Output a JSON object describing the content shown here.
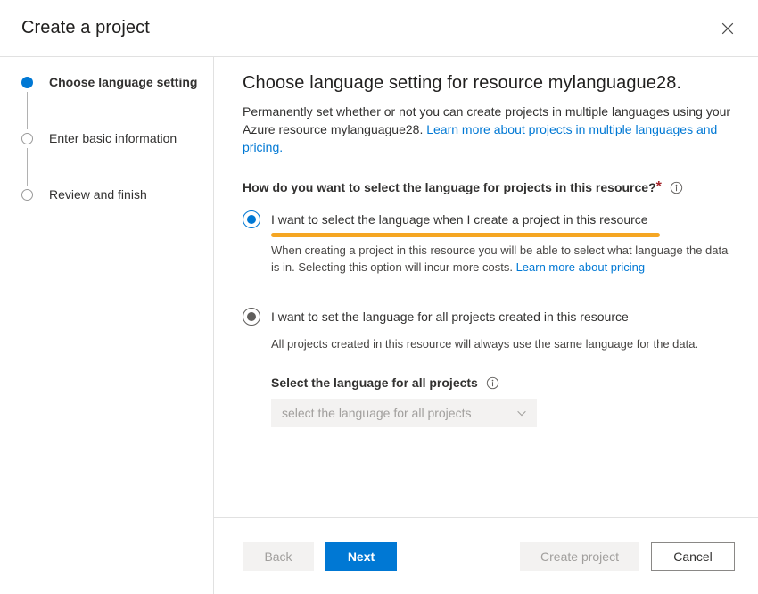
{
  "window": {
    "title": "Create a project",
    "close_icon": "close-icon"
  },
  "sidebar": {
    "steps": [
      {
        "label": "Choose language setting",
        "state": "active"
      },
      {
        "label": "Enter basic information",
        "state": "inactive"
      },
      {
        "label": "Review and finish",
        "state": "inactive"
      }
    ]
  },
  "main": {
    "heading": "Choose language setting for resource mylanguague28.",
    "description_part1": "Permanently set whether or not you can create projects in multiple languages using your Azure resource mylanguague28. ",
    "description_link": "Learn more about projects in multiple languages and pricing.",
    "question_label": "How do you want to select the language for projects in this resource?",
    "question_required_marker": "*",
    "question_info_icon": "info-icon",
    "options": [
      {
        "label": "I want to select the language when I create a project in this resource",
        "selected": true,
        "highlighted": true,
        "highlight_color": "#f5a623",
        "description_part1": "When creating a project in this resource you will be able to select what language the data is in. Selecting this option will incur more costs. ",
        "description_link": "Learn more about pricing"
      },
      {
        "label": "I want to set the language for all projects created in this resource",
        "selected": false,
        "hovered": true,
        "description_part1": "All projects created in this resource will always use the same language for the data.",
        "description_link": ""
      }
    ],
    "language_select": {
      "label": "Select the language for all projects",
      "info_icon": "info-icon",
      "placeholder": "select the language for all projects",
      "value": "",
      "disabled": true,
      "chevron_icon": "chevron-down-icon"
    }
  },
  "footer": {
    "back_label": "Back",
    "next_label": "Next",
    "create_label": "Create project",
    "cancel_label": "Cancel"
  },
  "colors": {
    "accent": "#0078d4",
    "highlight": "#f5a623",
    "required": "#a4262c",
    "border": "#e1e1e1"
  }
}
